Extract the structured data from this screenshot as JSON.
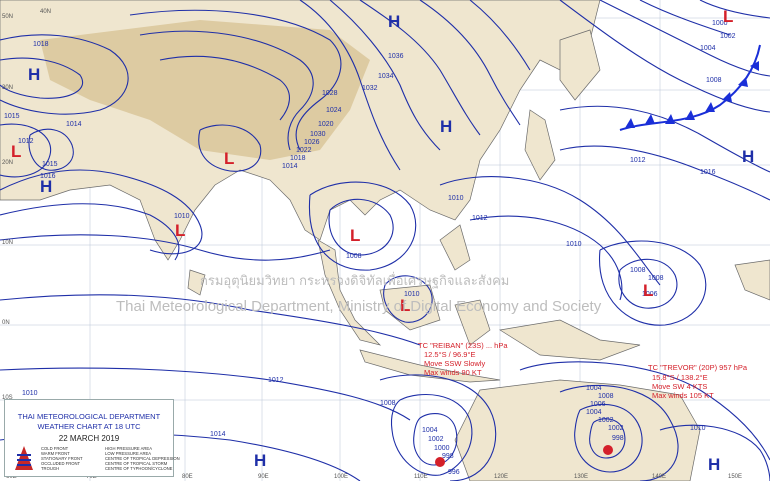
{
  "title": {
    "org": "THAI METEOROLOGICAL DEPARTMENT",
    "chart": "WEATHER CHART AT  18  UTC",
    "date": "22   MARCH   2019"
  },
  "watermark": {
    "thai": "กรมอุตุนิยมวิทยา กระทรวงดิจิทัลเพื่อเศรษฐกิจและสังคม",
    "english": "Thai Meteorological Department, Ministry of Digital Economy and Society"
  },
  "pressure_centers": [
    {
      "type": "H",
      "label": "H"
    },
    {
      "type": "H",
      "label": "H"
    },
    {
      "type": "H",
      "label": "H"
    },
    {
      "type": "H",
      "label": "H"
    },
    {
      "type": "H",
      "label": "H"
    },
    {
      "type": "H",
      "label": "H"
    },
    {
      "type": "H",
      "label": "H"
    },
    {
      "type": "L",
      "label": "L"
    },
    {
      "type": "L",
      "label": "L"
    },
    {
      "type": "L",
      "label": "L"
    },
    {
      "type": "L",
      "label": "L"
    },
    {
      "type": "L",
      "label": "L"
    },
    {
      "type": "L",
      "label": "L"
    },
    {
      "type": "L",
      "label": "L"
    }
  ],
  "isobar_labels": [
    "1018",
    "1015",
    "1014",
    "1012",
    "1015",
    "1016",
    "1028",
    "1024",
    "1020",
    "1032",
    "1034",
    "1036",
    "1030",
    "1026",
    "1022",
    "1018",
    "1014",
    "1010",
    "1008",
    "1010",
    "1004",
    "1002",
    "1008",
    "1010",
    "1012",
    "1016",
    "1012",
    "1014",
    "1010",
    "1008",
    "1006",
    "1010",
    "1012",
    "1008",
    "1010",
    "1004",
    "1002",
    "1000",
    "998",
    "1008",
    "1006",
    "1004",
    "1002",
    "998",
    "1004",
    "1002",
    "1000",
    "1008",
    "996"
  ],
  "storms": [
    {
      "name": "TC \"REIBAN\"",
      "lines": [
        "TC \"REIBAN\" (23S) ... hPa",
        "12.5°S / 96.9°E",
        "Move SSW Slowly",
        "Max winds 90 KT"
      ]
    },
    {
      "name": "TC \"TREVOR\"",
      "lines": [
        "TC \"TREVOR\" (20P) 957 hPa",
        "15.8°S / 138.2°E",
        "Move SW 4 KTS",
        "Max winds 105 KT"
      ]
    }
  ],
  "grid_ticks": [
    "40N",
    "30N",
    "20N",
    "10N",
    "0N",
    "10S",
    "80E",
    "90E",
    "100E",
    "110E",
    "120E",
    "130E",
    "140E",
    "150E",
    "70E",
    "60E",
    "50N"
  ],
  "legend": [
    "HIGH PRESSURE AREA",
    "LOW PRESSURE AREA",
    "CENTRE OF TROPICAL DEPRESSION",
    "CENTRE OF TROPICAL STORM",
    "CENTRE OF TYPHOON/CYCLONE",
    "COLD FRONT",
    "WARM FRONT",
    "STATIONARY FRONT",
    "OCCLUDED FRONT",
    "TROUGH"
  ],
  "colors": {
    "isobar": "#1f2fa8",
    "low": "#d4202a",
    "high": "#1f2fa8",
    "land": "#efe6cf",
    "highland": "#d9c59a",
    "front": "#1a2fd8"
  }
}
